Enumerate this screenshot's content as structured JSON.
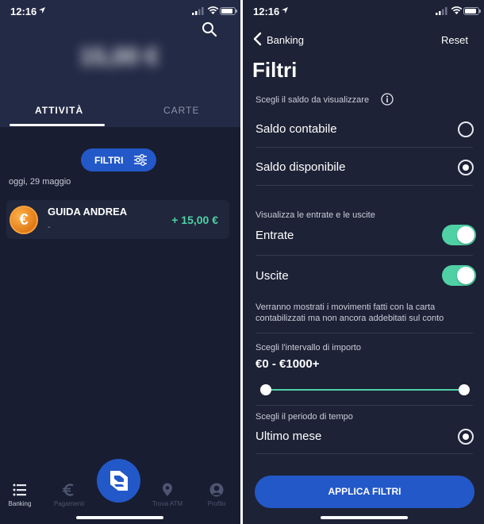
{
  "status_bar": {
    "time": "12:16"
  },
  "left_screen": {
    "balance": "15,00 €",
    "tabs": [
      {
        "label": "ATTIVITÀ",
        "active": true
      },
      {
        "label": "CARTE",
        "active": false
      }
    ],
    "filter_button": {
      "label": "FILTRI"
    },
    "date_label": "oggi, 29 maggio",
    "transaction": {
      "name": "GUIDA ANDREA",
      "subtitle": "-",
      "amount": "+ 15,00 €",
      "icon": "euro-coin-icon",
      "icon_glyph": "€"
    },
    "tabbar": [
      {
        "label": "Banking",
        "icon": "list-icon",
        "active": true
      },
      {
        "label": "Pagamenti",
        "icon": "euro-icon",
        "active": false
      },
      {
        "label": "Trova ATM",
        "icon": "map-pin-icon",
        "active": false
      },
      {
        "label": "Profilo",
        "icon": "profile-icon",
        "active": false
      }
    ]
  },
  "right_screen": {
    "back_label": "Banking",
    "reset_label": "Reset",
    "title": "Filtri",
    "balance_section": {
      "heading": "Scegli il saldo da visualizzare",
      "options": [
        {
          "label": "Saldo contabile",
          "selected": false
        },
        {
          "label": "Saldo disponibile",
          "selected": true
        }
      ]
    },
    "flows_section": {
      "heading": "Visualizza le entrate e le uscite",
      "toggles": [
        {
          "label": "Entrate",
          "on": true
        },
        {
          "label": "Uscite",
          "on": true
        }
      ],
      "note": "Verranno mostrati i movimenti fatti con la carta contabilizzati ma non ancora addebitati sul conto"
    },
    "amount_section": {
      "heading": "Scegli l'intervallo di importo",
      "range_label": "€0 - €1000+",
      "min_value": 0,
      "max_value": 1000
    },
    "period_section": {
      "heading": "Scegli il periodo di tempo",
      "option": {
        "label": "Ultimo mese",
        "selected": true
      }
    },
    "apply_button": "APPLICA FILTRI"
  },
  "colors": {
    "background": "#181d31",
    "accent_blue": "#2358c8",
    "positive_green": "#4fd1a5",
    "coin_orange": "#e07b17"
  }
}
